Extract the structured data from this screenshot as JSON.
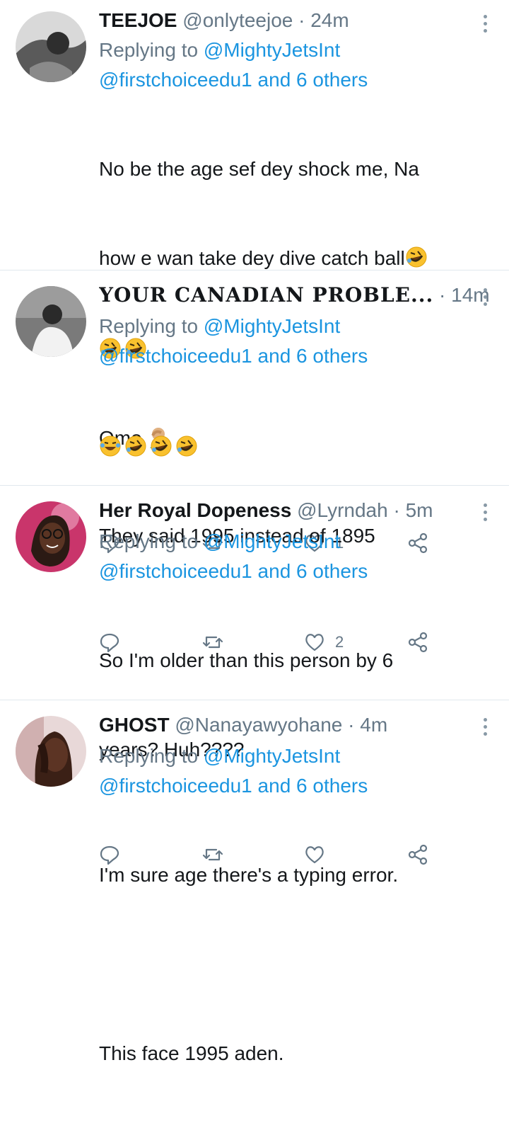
{
  "tweets": [
    {
      "name": "TEEJOE",
      "handle": "@onlyteejoe",
      "dot": "·",
      "time": "24m",
      "replying_prefix": "Replying to",
      "replying_user": "@MightyJetsInt",
      "replying_second": "@firstchoiceedu1",
      "replying_and": "and",
      "replying_others": "6 others",
      "body_lines": [
        "No be the age sef dey shock me, Na",
        "how e wan take dey dive catch ball"
      ],
      "body_after": "Omo",
      "likes": "1",
      "avatar_color": "#6b6b6b"
    },
    {
      "name": "YOUR CANADIAN PROBLE...",
      "handle": "",
      "dot": "·",
      "time": "14m",
      "replying_prefix": "Replying to",
      "replying_user": "@MightyJetsInt",
      "replying_second": "@firstchoiceedu1",
      "replying_and": "and",
      "replying_others": "6 others",
      "body_text": "They said 1995 instead of 1895",
      "likes": "2",
      "avatar_color": "#3a3a3a"
    },
    {
      "name": "Her Royal Dopeness",
      "handle": "@Lyrndah",
      "dot": "·",
      "time": "5m",
      "replying_prefix": "Replying to",
      "replying_user": "@MightyJetsInt",
      "replying_second": "@firstchoiceedu1",
      "replying_and": "and",
      "replying_others": "6 others",
      "body_lines": [
        "So I'm older than this person by 6",
        "years? Huh????"
      ],
      "likes": "",
      "avatar_color": "#c04a6a"
    },
    {
      "name": "GHOST",
      "handle": "@Nanayawyohane",
      "dot": "·",
      "time": "4m",
      "replying_prefix": "Replying to",
      "replying_user": "@MightyJetsInt",
      "replying_second": "@firstchoiceedu1",
      "replying_and": "and",
      "replying_others": "6 others",
      "body_lines": [
        "I'm sure age there's a typing error.",
        "",
        "This face 1995 aden."
      ],
      "avatar_color": "#5a3a2e"
    }
  ],
  "colors": {
    "link": "#1b95e0",
    "muted": "#657786",
    "divider": "#e1e8ed"
  },
  "icons": [
    "reply-icon",
    "retweet-icon",
    "like-icon",
    "share-icon",
    "more-icon"
  ]
}
